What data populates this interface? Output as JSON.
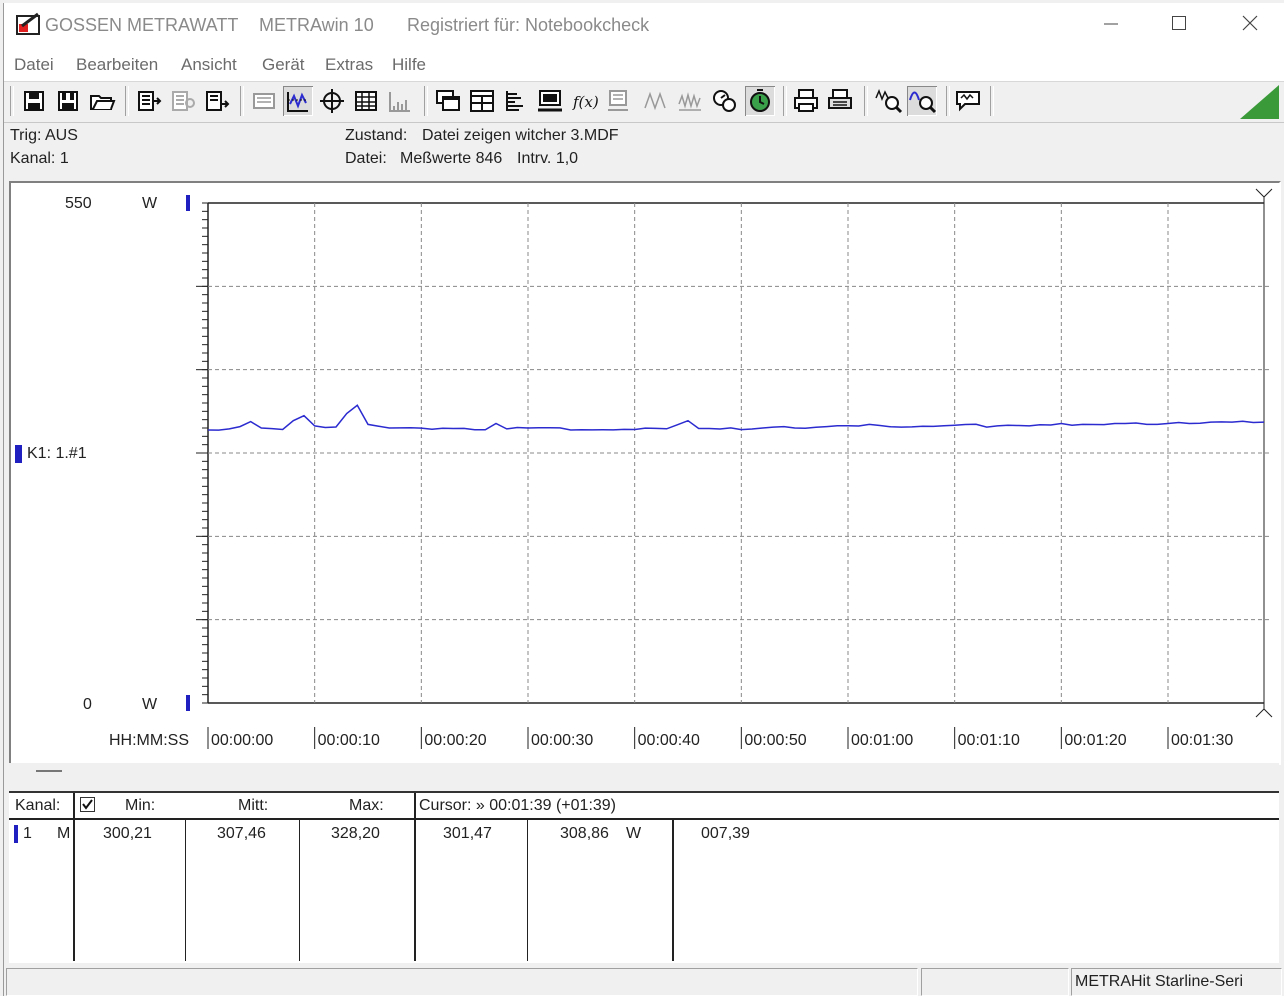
{
  "titlebar": {
    "brand": "GOSSEN METRAWATT",
    "app": "METRAwin 10",
    "registered": "Registriert für: Notebookcheck"
  },
  "menu": [
    "Datei",
    "Bearbeiten",
    "Ansicht",
    "Gerät",
    "Extras",
    "Hilfe"
  ],
  "info": {
    "trig": "Trig: AUS",
    "kanal": "Kanal: 1",
    "zustand_label": "Zustand:",
    "zustand_value": "Datei zeigen witcher 3.MDF",
    "datei_label": "Datei:",
    "messwerte": "Meßwerte 846",
    "intervall": "Intrv. 1,0"
  },
  "chart_data": {
    "type": "line",
    "ylim": [
      0,
      550
    ],
    "y_top_label": "550",
    "y_bottom_label": "0",
    "y_unit": "W",
    "channel_label": "K1: 1.#1",
    "x_axis_label": "HH:MM:SS",
    "x_ticks": [
      "00:00:00",
      "00:00:10",
      "00:00:20",
      "00:00:30",
      "00:00:40",
      "00:00:50",
      "00:01:00",
      "00:01:10",
      "00:01:20",
      "00:01:30"
    ],
    "xlim_seconds": [
      0,
      99
    ],
    "grid": true,
    "line_color": "#2b2bd0",
    "series": [
      {
        "x": [
          0,
          1,
          2,
          3,
          4,
          5,
          6,
          7,
          8,
          9,
          10,
          11,
          12,
          13,
          14,
          15,
          16,
          17,
          18,
          19,
          20,
          21,
          22,
          23,
          24,
          25,
          26,
          27,
          28,
          29,
          30,
          31,
          32,
          33,
          34,
          35,
          36,
          37,
          38,
          39,
          40,
          41,
          42,
          43,
          44,
          45,
          46,
          47,
          48,
          49,
          50,
          51,
          52,
          53,
          54,
          55,
          56,
          57,
          58,
          59,
          60,
          61,
          62,
          63,
          64,
          65,
          66,
          67,
          68,
          69,
          70,
          71,
          72,
          73,
          74,
          75,
          76,
          77,
          78,
          79,
          80,
          81,
          82,
          83,
          84,
          85,
          86,
          87,
          88,
          89,
          90,
          91,
          92,
          93,
          94,
          95,
          96,
          97,
          98,
          99
        ],
        "values": [
          300.3,
          300.2,
          301.5,
          304,
          309.5,
          302.5,
          301.8,
          300.8,
          310.5,
          316,
          304.8,
          303,
          303.6,
          318.5,
          327.5,
          306.5,
          304.5,
          302.5,
          302.6,
          302.8,
          302.4,
          301.2,
          302.3,
          302,
          302.1,
          300.6,
          300.5,
          307.5,
          301.5,
          303,
          302.5,
          302.7,
          302.8,
          302.6,
          300.3,
          300.5,
          300.4,
          300.5,
          300.4,
          301,
          300.8,
          302.4,
          302.1,
          301.6,
          306,
          310.5,
          302,
          302,
          301.4,
          302.6,
          300.7,
          301.4,
          302.5,
          303.5,
          304,
          302.5,
          302.3,
          303.3,
          304,
          305,
          304.9,
          304.7,
          306.5,
          305.2,
          303.8,
          303.5,
          303.7,
          304.5,
          304.3,
          304.9,
          305.6,
          306.3,
          306.6,
          303.5,
          304.8,
          305.5,
          305.3,
          304.8,
          306,
          305.8,
          307.5,
          305.5,
          306.5,
          306.4,
          306.2,
          307.5,
          307.4,
          308,
          306.5,
          306.5,
          307.5,
          308.5,
          307.5,
          307.7,
          309,
          309.2,
          309,
          310,
          308.5,
          309
        ]
      }
    ]
  },
  "table": {
    "headers": {
      "kanal": "Kanal:",
      "min": "Min:",
      "mitt": "Mitt:",
      "max": "Max:",
      "cursor": "Cursor: » 00:01:39 (+01:39)"
    },
    "row": {
      "channel": "1",
      "mode": "M",
      "min": "300,21",
      "mitt": "307,46",
      "max": "328,20",
      "cursor_value": "301,47",
      "cursor_value2": "308,86",
      "unit": "W",
      "extra": "007,39"
    }
  },
  "statusbar": {
    "device": "METRAHit Starline-Seri"
  }
}
